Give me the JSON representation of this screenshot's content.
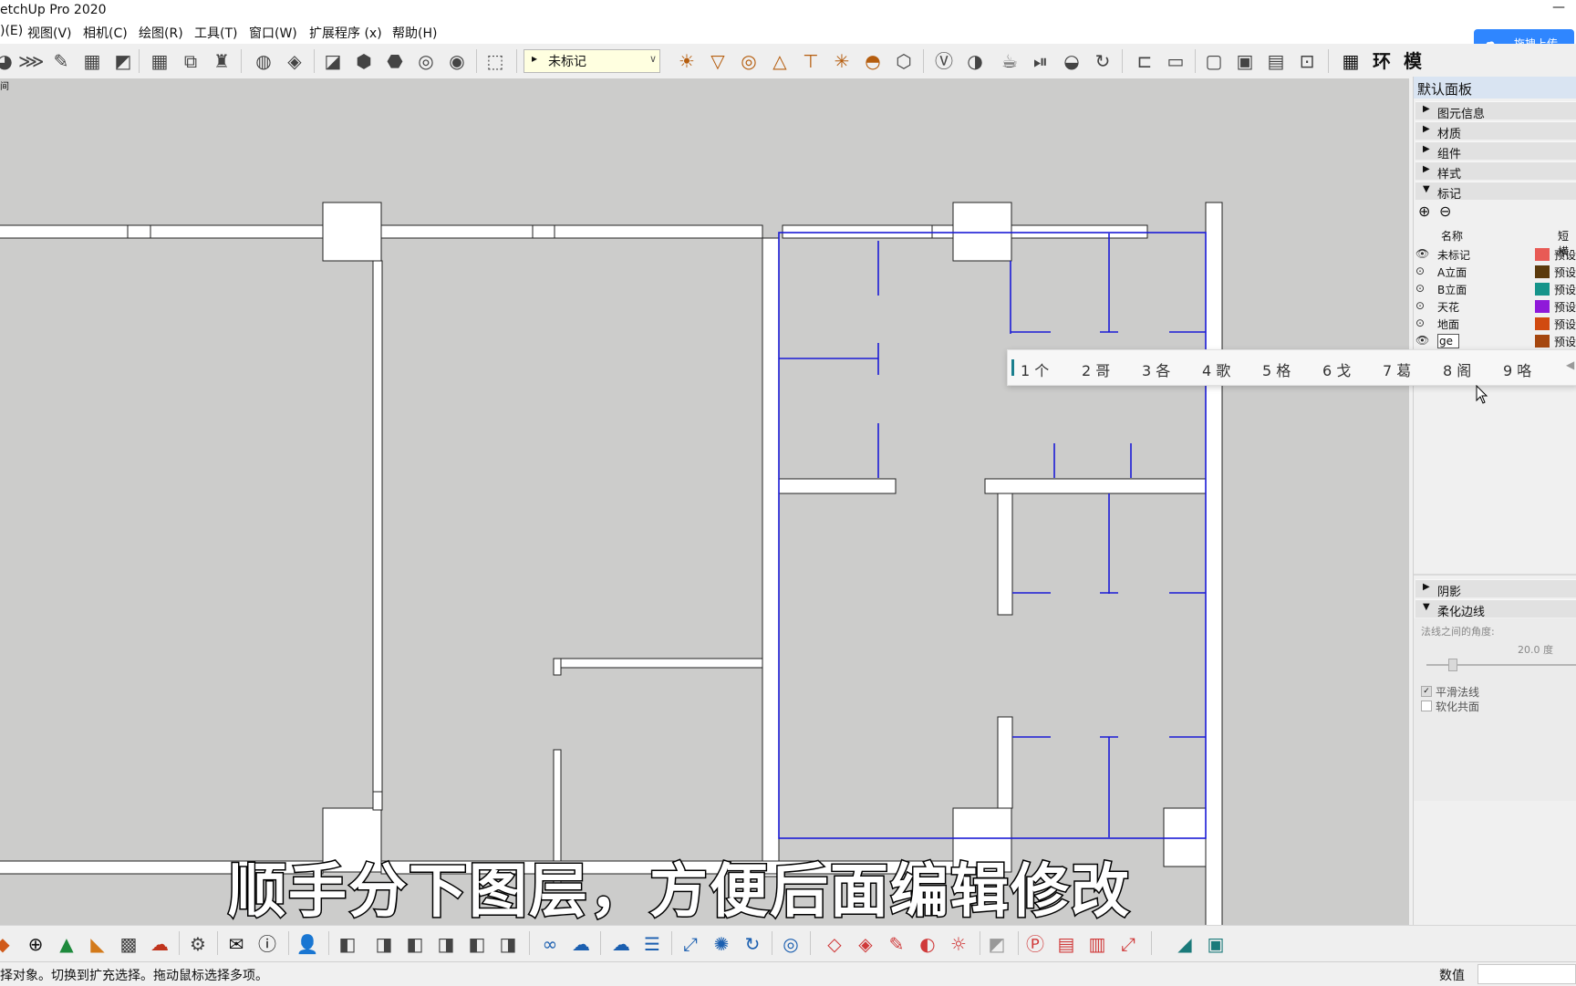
{
  "window": {
    "title": "etchUp Pro 2020",
    "minimize_glyph": "—"
  },
  "menu": [
    {
      "label": ")(E)"
    },
    {
      "label": "视图(V)"
    },
    {
      "label": "相机(C)"
    },
    {
      "label": "绘图(R)"
    },
    {
      "label": "工具(T)"
    },
    {
      "label": "窗口(W)"
    },
    {
      "label": "扩展程序 (x)"
    },
    {
      "label": "帮助(H)"
    }
  ],
  "toolbar": {
    "tag_select": {
      "value": "未标记"
    },
    "upload": {
      "label": "拖拽上传",
      "icon": "cloud-icon"
    },
    "right_labels": [
      "环",
      "模"
    ]
  },
  "viewport": {
    "corner_label": "间"
  },
  "panel": {
    "title": "默认面板",
    "sections_top": [
      {
        "label": "图元信息",
        "expanded": false
      },
      {
        "label": "材质",
        "expanded": false
      },
      {
        "label": "组件",
        "expanded": false
      },
      {
        "label": "样式",
        "expanded": false
      },
      {
        "label": "标记",
        "expanded": true
      }
    ],
    "tags_header": {
      "name": "名称",
      "short": "短横"
    },
    "tags": [
      {
        "name": "未标记",
        "color": "#e85a55",
        "line": "预设",
        "visible": true
      },
      {
        "name": "A立面",
        "color": "#5b3a0c",
        "line": "预设",
        "visible": false
      },
      {
        "name": "B立面",
        "color": "#16948a",
        "line": "预设",
        "visible": false
      },
      {
        "name": "天花",
        "color": "#8f19d9",
        "line": "预设",
        "visible": false
      },
      {
        "name": "地面",
        "color": "#d14a10",
        "line": "预设",
        "visible": false
      },
      {
        "name": "ge",
        "color": "#a5460e",
        "line": "预设",
        "visible": true
      }
    ],
    "sections_bottom": [
      {
        "label": "阴影",
        "expanded": false
      },
      {
        "label": "柔化边线",
        "expanded": true
      }
    ],
    "soften": {
      "angle_label": "法线之间的角度:",
      "angle_value": "20.0  度",
      "slider_fraction": 0.15,
      "smooth_label": "平滑法线",
      "smooth_checked": true,
      "coplanar_label": "软化共面",
      "coplanar_checked": false
    }
  },
  "ime": {
    "candidates": [
      "1 个",
      "2 哥",
      "3 各",
      "4 歌",
      "5 格",
      "6 戈",
      "7 葛",
      "8 阁",
      "9 咯"
    ],
    "nav_glyph": "◀"
  },
  "status": {
    "text": "择对象。切换到扩充选择。拖动鼠标选择多项。",
    "value_label": "数值"
  },
  "subtitle": "顺手分下图层，方便后面编辑修改"
}
